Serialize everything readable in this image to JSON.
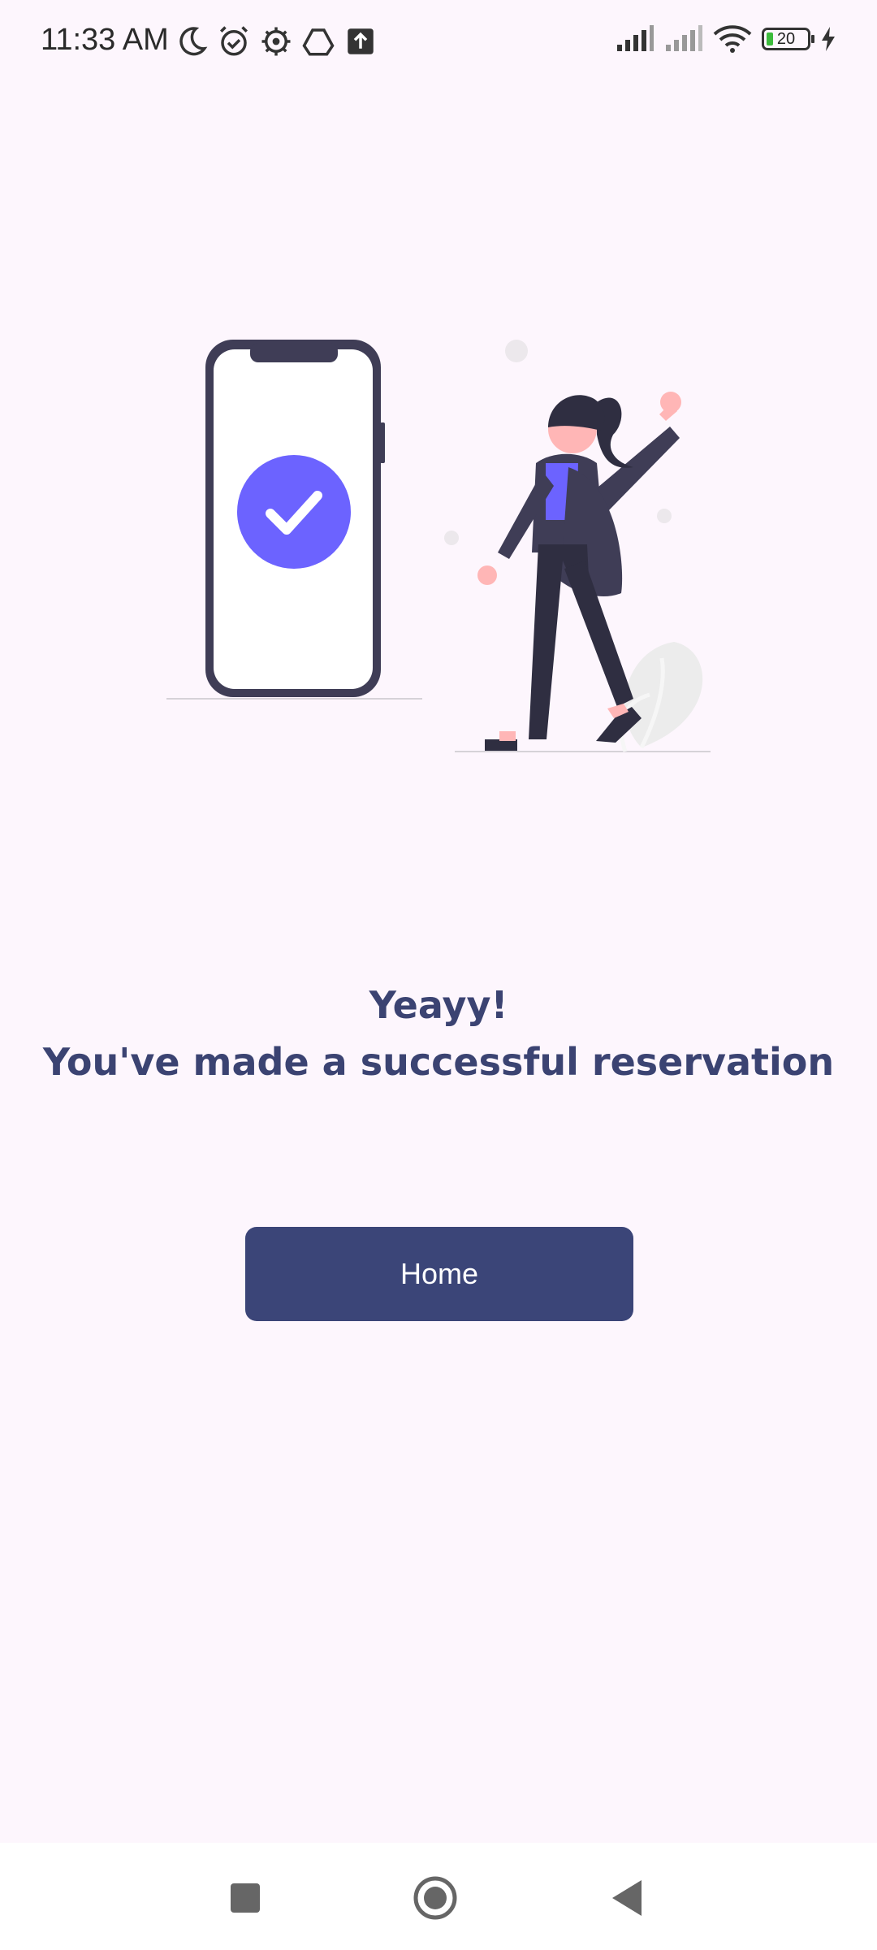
{
  "status_bar": {
    "time": "11:33 AM",
    "battery_level": "20"
  },
  "message": {
    "line1": "Yeayy!",
    "line2": "You've made a successful reservation"
  },
  "home_button": {
    "label": "Home"
  },
  "colors": {
    "background": "#fdf6fd",
    "accent": "#3b4578",
    "title": "#3b4372",
    "check_circle": "#6c63ff"
  },
  "icons": [
    "moon-icon",
    "alarm-icon",
    "settings-icon",
    "drive-icon",
    "upload-icon",
    "signal-icon",
    "wifi-icon",
    "battery-icon",
    "charging-icon",
    "recent-apps-icon",
    "home-nav-icon",
    "back-icon"
  ]
}
